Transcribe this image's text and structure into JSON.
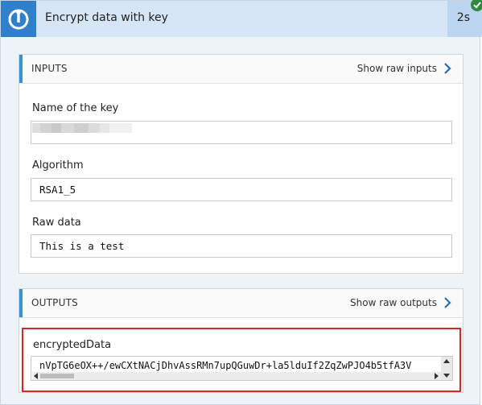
{
  "header": {
    "title": "Encrypt data with key",
    "duration": "2s",
    "action_icon": "keyvault-icon",
    "status_icon": "checkmark-icon",
    "accent_color": "#2f7fc9"
  },
  "inputs": {
    "title": "INPUTS",
    "raw_link": "Show raw inputs",
    "fields": [
      {
        "label": "Name of the key",
        "value": ""
      },
      {
        "label": "Algorithm",
        "value": "RSA1_5"
      },
      {
        "label": "Raw data",
        "value": "This is a test"
      }
    ]
  },
  "outputs": {
    "title": "OUTPUTS",
    "raw_link": "Show raw outputs",
    "fields": [
      {
        "label": "encryptedData",
        "value": "nVpTG6eOX++/ewCXtNACjDhvAssRMn7upQGuwDr+la5lduIf2ZqZwPJO4b5tfA3V"
      }
    ],
    "highlight_color": "#d62626"
  }
}
